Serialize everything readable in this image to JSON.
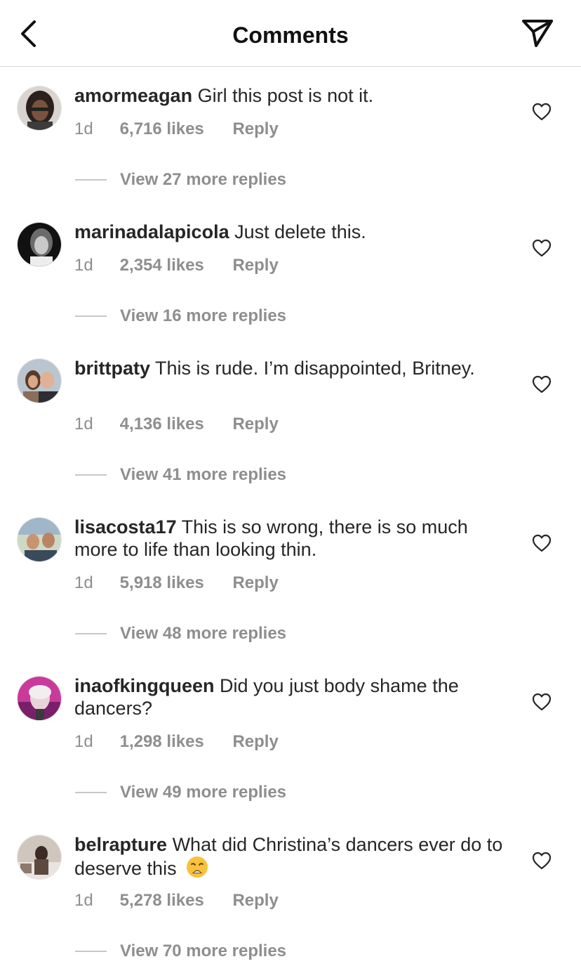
{
  "header": {
    "title": "Comments",
    "back_icon": "chevron-left-icon",
    "share_icon": "paper-plane-icon"
  },
  "colors": {
    "text": "#262626",
    "muted": "#8e8e8e",
    "divider": "#dbdbdb"
  },
  "comments": [
    {
      "username": "amormeagan",
      "text": "Girl this post is not it.",
      "time": "1d",
      "likes": "6,716 likes",
      "reply": "Reply",
      "view_replies": "View 27 more replies"
    },
    {
      "username": "marinadalapicola",
      "text": "Just delete this.",
      "time": "1d",
      "likes": "2,354 likes",
      "reply": "Reply",
      "view_replies": "View 16 more replies"
    },
    {
      "username": "brittpaty",
      "text": "This is rude. I’m disappointed, Britney.",
      "time": "1d",
      "likes": "4,136 likes",
      "reply": "Reply",
      "view_replies": "View 41 more replies"
    },
    {
      "username": "lisacosta17",
      "text": "This is so wrong, there is so much more to life than looking thin.",
      "time": "1d",
      "likes": "5,918 likes",
      "reply": "Reply",
      "view_replies": "View 48 more replies"
    },
    {
      "username": "inaofkingqueen",
      "text": "Did you just body shame the dancers?",
      "time": "1d",
      "likes": "1,298 likes",
      "reply": "Reply",
      "view_replies": "View 49 more replies"
    },
    {
      "username": "belrapture",
      "text": "What did Christina’s dancers ever do to deserve this",
      "emoji": "weary-face-emoji",
      "time": "1d",
      "likes": "5,278 likes",
      "reply": "Reply",
      "view_replies": "View 70 more replies"
    }
  ]
}
